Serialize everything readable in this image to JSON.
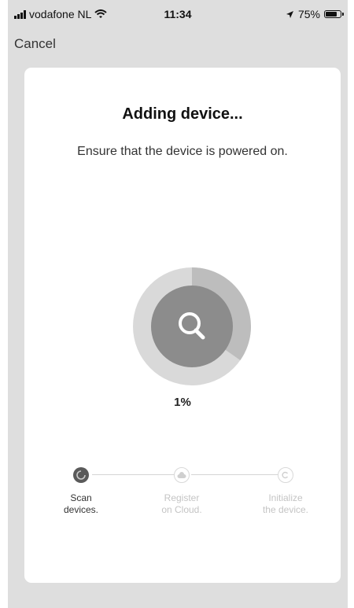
{
  "status_bar": {
    "carrier": "vodafone NL",
    "time": "11:34",
    "battery": "75%",
    "battery_level": 0.75
  },
  "nav": {
    "cancel_label": "Cancel"
  },
  "main": {
    "title": "Adding device...",
    "subtitle": "Ensure that the device is powered on.",
    "progress_percent": "1%",
    "progress_value": 0.01
  },
  "steps": [
    {
      "label": "Scan\ndevices.",
      "state": "active",
      "icon": "scan-icon"
    },
    {
      "label": "Register\non Cloud.",
      "state": "pending",
      "icon": "cloud-icon"
    },
    {
      "label": "Initialize\nthe device.",
      "state": "pending",
      "icon": "copyright-c-icon"
    }
  ],
  "colors": {
    "background": "#dedede",
    "card": "#ffffff",
    "ring_outer": "#d9d9d9",
    "ring_progress": "#bdbdbd",
    "ring_inner": "#8c8c8c",
    "active_step": "#5a5a5a",
    "pending_step": "#cfcfcf",
    "pending_text": "#c4c4c4"
  }
}
